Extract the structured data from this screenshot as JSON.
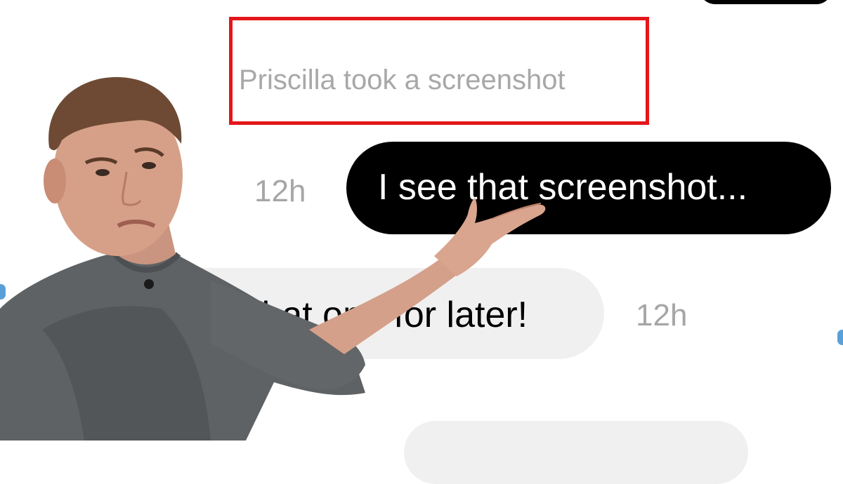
{
  "system_notice": {
    "text": "Priscilla took a screenshot"
  },
  "messages": [
    {
      "direction": "sent",
      "text": "I see that screenshot...",
      "time": "12h"
    },
    {
      "direction": "received",
      "text": "that one for later!",
      "time": "12h"
    }
  ],
  "colors": {
    "sent_bubble": "#000000",
    "received_bubble": "#f0f0f0",
    "highlight_box": "#e4161b",
    "meta_text": "#a6a6a6"
  }
}
